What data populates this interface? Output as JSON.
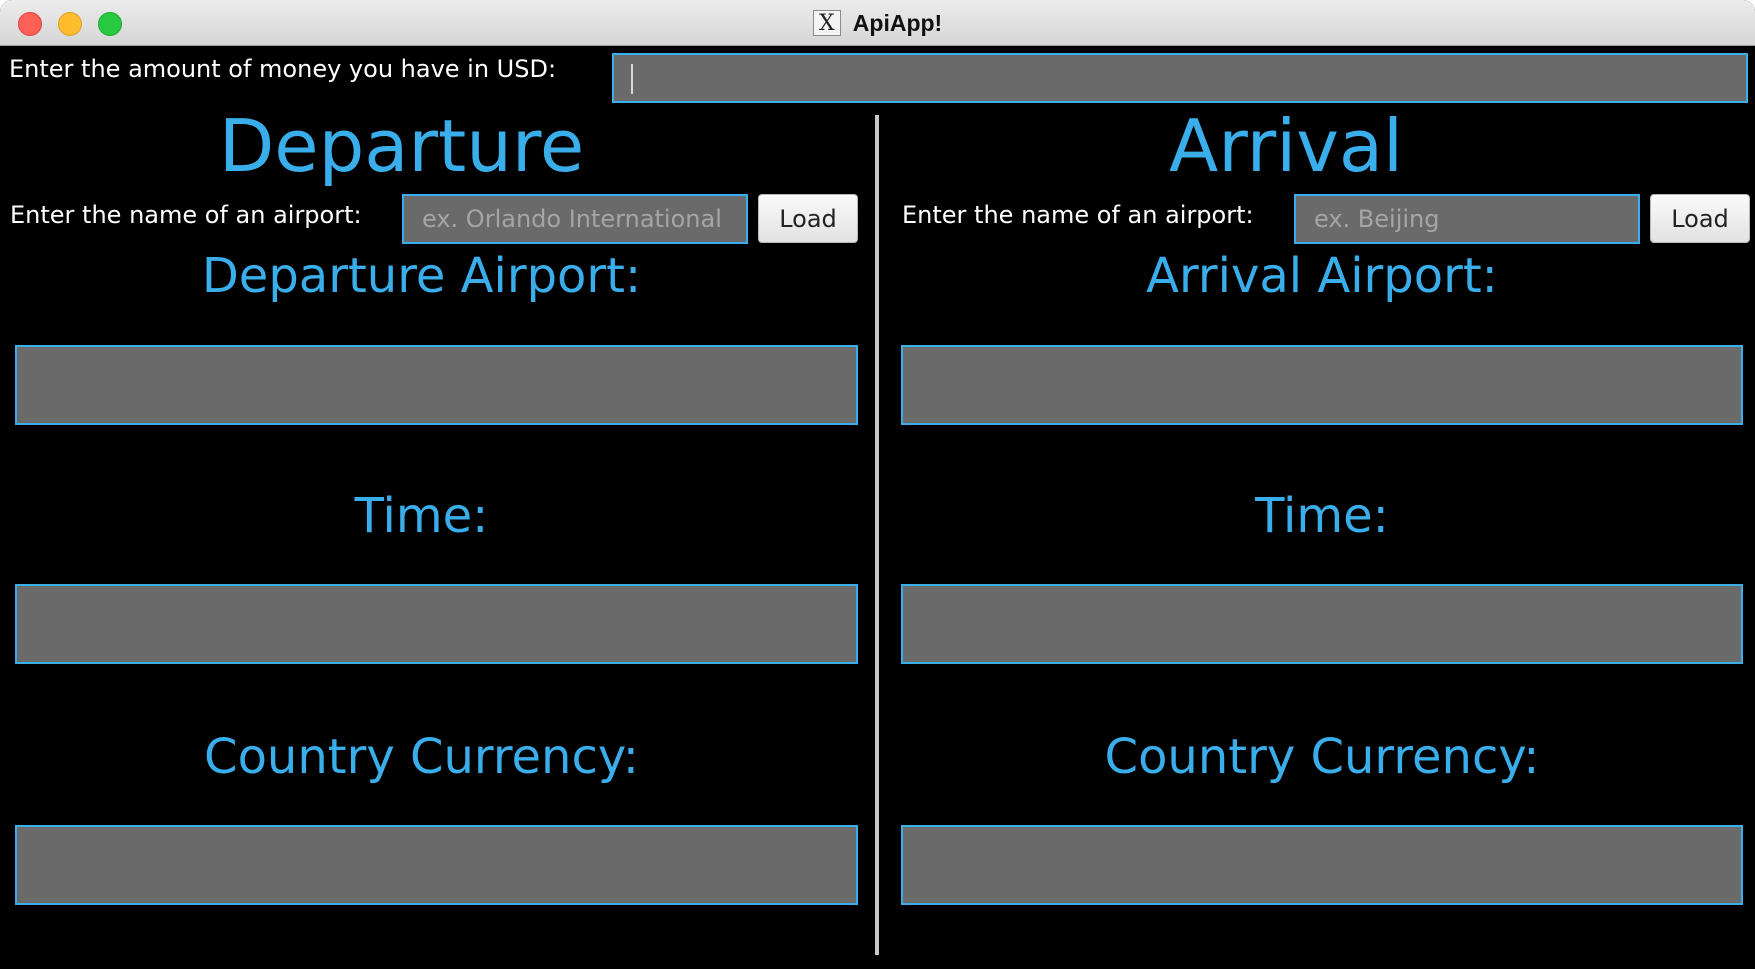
{
  "window": {
    "title": "ApiApp!",
    "icon": "x11-icon"
  },
  "usd": {
    "label": "Enter the amount of money you have in USD:",
    "value": ""
  },
  "departure": {
    "heading": "Departure",
    "airport_label": "Enter the name of an airport:",
    "airport_placeholder": "ex. Orlando International",
    "load_label": "Load",
    "airport_section": "Departure Airport:",
    "time_section": "Time:",
    "currency_section": "Country Currency:"
  },
  "arrival": {
    "heading": "Arrival",
    "airport_label": "Enter the name of an airport:",
    "airport_placeholder": "ex. Beijing",
    "load_label": "Load",
    "airport_section": "Arrival Airport:",
    "time_section": "Time:",
    "currency_section": "Country Currency:"
  },
  "colors": {
    "accent": "#3aaeea",
    "field_bg": "#6a6a6a",
    "background": "#000000"
  }
}
